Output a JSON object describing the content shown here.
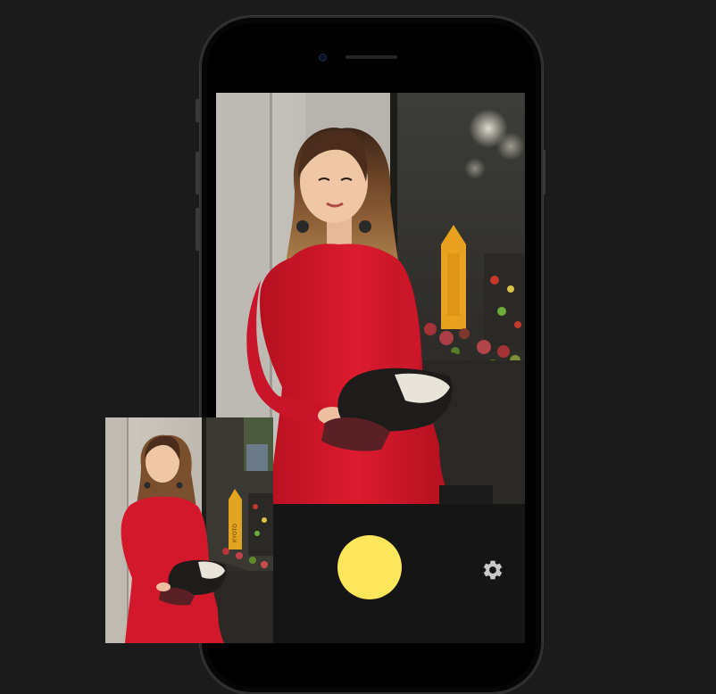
{
  "screen": {
    "shutter": {
      "label": "",
      "color": "#fde65a"
    },
    "settings": {
      "icon": "gear-icon",
      "color": "#c9c9c9"
    },
    "preview": {
      "description_icon": "photo-preview"
    }
  },
  "thumbnail": {
    "icon": "thumbnail-photo"
  },
  "sign": {
    "text": "KYOTO"
  },
  "colors": {
    "background": "#1b1b1b",
    "dress": "#d4182b",
    "shutter": "#fde65a",
    "controls_bg": "#151515"
  }
}
